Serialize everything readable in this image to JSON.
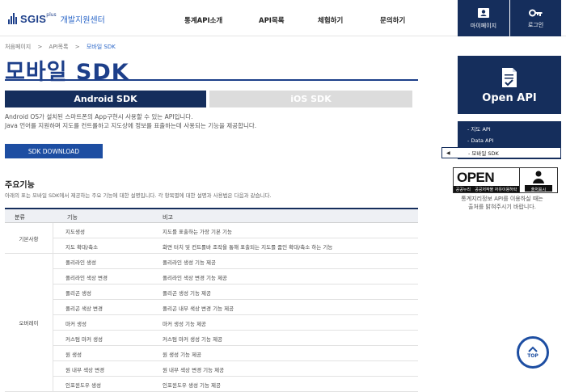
{
  "header": {
    "logo_text": "SGIS",
    "logo_plus": "plus",
    "logo_sub": "개발지원센터",
    "nav": [
      "통계API소개",
      "API목록",
      "체험하기",
      "문의하기"
    ],
    "mypage_label": "마이페이지",
    "login_label": "로그인"
  },
  "breadcrumb": [
    "처음페이지",
    ">",
    "API목록",
    ">",
    "모바일 SDK"
  ],
  "page_title": "모바일 SDK",
  "tabs": {
    "android": "Android SDK",
    "ios": "iOS SDK"
  },
  "intro": {
    "line1": "Android OS가 설치된 스마트폰의 App구현시 사용할 수 있는 API입니다.",
    "line2": "Java 언어를 지원하며 지도를 컨트롤하고 지도상에 정보를 표출하는데 사용되는 기능을 제공합니다."
  },
  "download_label": "SDK DOWNLOAD",
  "features": {
    "title": "주요기능",
    "desc": "아래의 표는 모바일 SDK에서 제공하는 주요 기능에 대한 설명입니다. 각 항목별에 대한 설명과 사용법은 다음과 같습니다.",
    "headers": [
      "분류",
      "기능",
      "비고"
    ],
    "groups": [
      "기본사항",
      "오버레이"
    ],
    "rows": [
      {
        "feature": "지도생성",
        "note": "지도를 표출하는 가장 기본 기능"
      },
      {
        "feature": "지도 확대/축소",
        "note": "화면 터치 및 컨트롤바 조작을 통해 표출되는 지도를 줌인 확대/축소 하는 기능"
      },
      {
        "feature": "폴리라인 생성",
        "note": "폴리라인 생성 기능 제공"
      },
      {
        "feature": "폴리라인 색상 변경",
        "note": "폴리라인 색상 변경 기능 제공"
      },
      {
        "feature": "폴리곤 생성",
        "note": "폴리곤 생성 기능 제공"
      },
      {
        "feature": "폴리곤 색상 변경",
        "note": "폴리곤 내부 색상 변경 기능 제공"
      },
      {
        "feature": "마커 생성",
        "note": "마커 생성 기능 제공"
      },
      {
        "feature": "커스텀 마커 생성",
        "note": "커스텀 마커 생성 기능 제공"
      },
      {
        "feature": "원 생성",
        "note": "원 생성 기능 제공"
      },
      {
        "feature": "원 내부 색상 변경",
        "note": "원 내부 색상 변경 기능 제공"
      },
      {
        "feature": "인포윈도우 생성",
        "note": "인포윈도우 생성 기능 제공"
      }
    ]
  },
  "sidebar": {
    "open_api_title": "Open API",
    "menu": [
      {
        "label": "- 지도 API"
      },
      {
        "label": "- Data API"
      },
      {
        "label": "- 모바일 SDK"
      }
    ]
  },
  "ogl": {
    "open_text": "OPEN",
    "sub_left": "공공누리",
    "sub_right": "공공저작물 자유이용허락",
    "badge": "출처표시",
    "note1": "통계지리정보 API를 이용하실 때는",
    "note2": "출처를 밝혀주시기 바랍니다."
  },
  "top_button_label": "TOP"
}
